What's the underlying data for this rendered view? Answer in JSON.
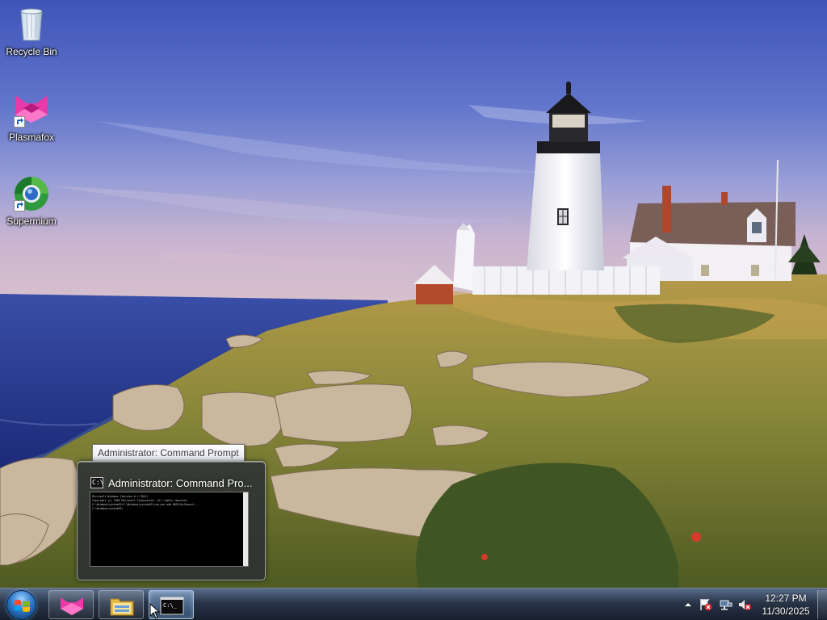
{
  "desktop": {
    "icons": [
      {
        "label": "Recycle Bin",
        "icon": "recycle-bin-icon"
      },
      {
        "label": "Plasmafox",
        "icon": "plasmafox-icon"
      },
      {
        "label": "Supermium",
        "icon": "supermium-icon"
      }
    ]
  },
  "tooltip": {
    "text": "Administrator:  Command Prompt"
  },
  "thumbnail": {
    "title": "Administrator:  Command Pro...",
    "console_lines": [
      "Microsoft Windows [Version 6.1.7601]",
      "Copyright (c) 2009 Microsoft Corporation.  All rights reserved.",
      "",
      "C:\\Windows\\system32>C:\\Windows\\system32\\reg.exe add HKCU\\Software\\...",
      "",
      "C:\\Windows\\system32>"
    ]
  },
  "taskbar": {
    "start_icon": "windows-orb-icon",
    "buttons": [
      {
        "name": "plasmafox",
        "icon": "plasmafox-icon"
      },
      {
        "name": "explorer",
        "icon": "folder-icon"
      },
      {
        "name": "cmd",
        "icon": "command-prompt-icon"
      }
    ],
    "tray": {
      "show_hidden_icon": "chevron-up-icon",
      "icons": [
        "action-center-icon",
        "network-icon",
        "volume-muted-icon"
      ]
    },
    "clock": {
      "time": "12:27 PM",
      "date": "11/30/2025"
    }
  },
  "colors": {
    "sky_top": "#4a63c0",
    "sea": "#26358a",
    "grass": "#8a8a3a",
    "taskbar": "#1c2838",
    "accent_magenta": "#e83aa8"
  }
}
